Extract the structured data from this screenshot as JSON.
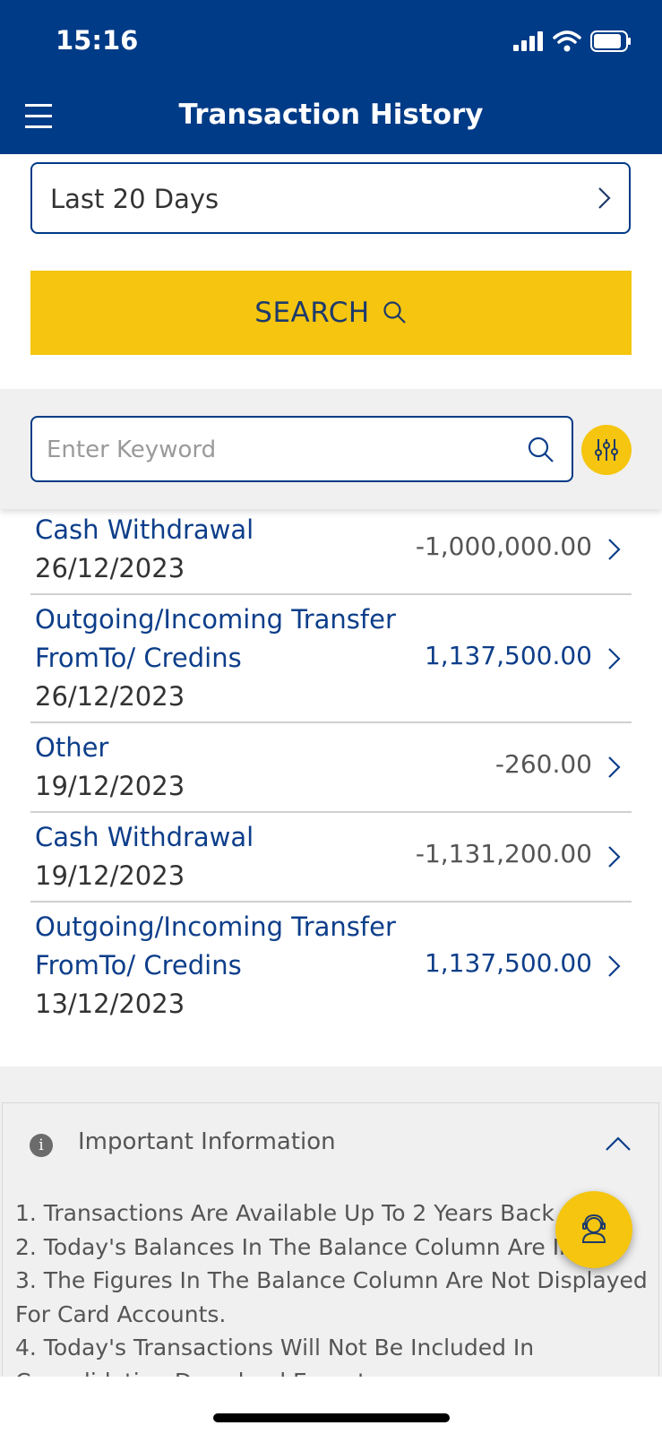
{
  "status_bar": {
    "time": "15:16",
    "icons": [
      "cellular-signal-icon",
      "wifi-icon",
      "battery-icon"
    ]
  },
  "header": {
    "menu_icon": "hamburger-menu-icon",
    "title": "Transaction History"
  },
  "date_range": {
    "value": "Last 20 Days",
    "icon": "chevron-right-icon"
  },
  "search_button": {
    "label": "SEARCH",
    "icon": "search-icon"
  },
  "keyword_search": {
    "placeholder": "Enter Keyword",
    "value": "",
    "icon": "search-icon",
    "filter_icon": "sliders-filter-icon"
  },
  "transactions": [
    {
      "title_lines": [
        "Cash Withdrawal"
      ],
      "date": "26/12/2023",
      "amount": "-1,000,000.00",
      "sign": "neg"
    },
    {
      "title_lines": [
        "Outgoing/Incoming Transfer",
        "FromTo/ Credins"
      ],
      "date": "26/12/2023",
      "amount": "1,137,500.00",
      "sign": "pos"
    },
    {
      "title_lines": [
        "Other"
      ],
      "date": "19/12/2023",
      "amount": "-260.00",
      "sign": "neg"
    },
    {
      "title_lines": [
        "Cash Withdrawal"
      ],
      "date": "19/12/2023",
      "amount": "-1,131,200.00",
      "sign": "neg"
    },
    {
      "title_lines": [
        "Outgoing/Incoming Transfer",
        "FromTo/ Credins"
      ],
      "date": "13/12/2023",
      "amount": "1,137,500.00",
      "sign": "pos"
    }
  ],
  "important_info": {
    "icon_glyph": "i",
    "title": "Important Information",
    "collapse_icon": "chevron-up-icon",
    "lines": [
      "1. Transactions Are Available Up To 2 Years Back",
      "2. Today's Balances In The Balance Column Are Indi",
      "3. The Figures In The Balance Column Are Not Displayed",
      "For Card Accounts.",
      "4. Today's Transactions Will Not Be Included In",
      "Consolidation Download Export"
    ]
  },
  "fab": {
    "icon": "support-agent-icon"
  },
  "colors": {
    "primary": "#003b87",
    "accent": "#f5c50f",
    "text_blue": "#0d3e8a",
    "text_gray": "#555555"
  }
}
